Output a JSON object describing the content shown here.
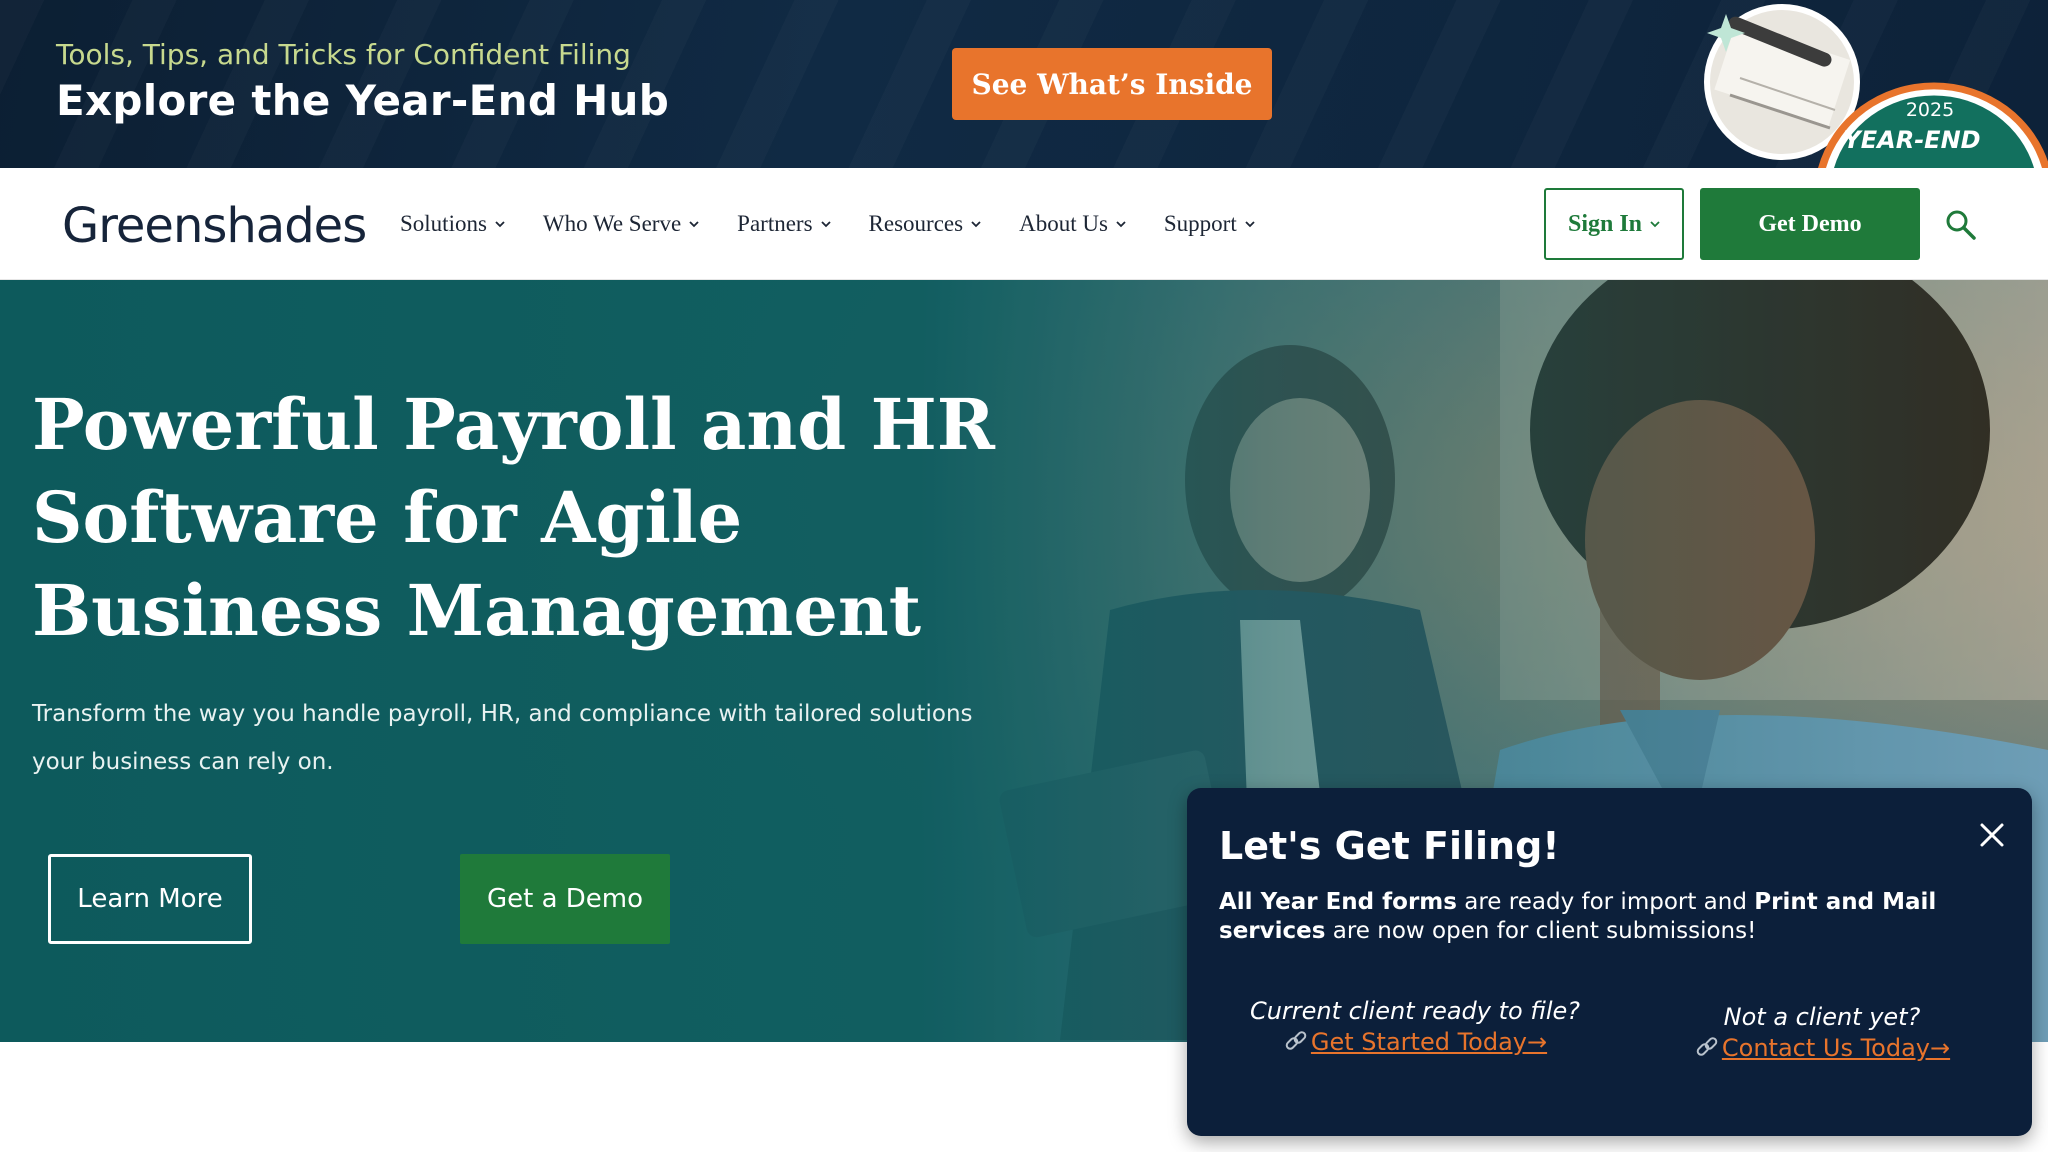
{
  "promo": {
    "kicker": "Tools, Tips, and Tricks for Confident Filing",
    "title": "Explore the Year-End Hub",
    "cta": "See What’s Inside",
    "badge_year": "2025",
    "badge_label": "YEAR-END",
    "cta_color": "#e8742c"
  },
  "header": {
    "logo": "Greenshades",
    "nav": [
      {
        "label": "Solutions"
      },
      {
        "label": "Who We Serve"
      },
      {
        "label": "Partners"
      },
      {
        "label": "Resources"
      },
      {
        "label": "About Us"
      },
      {
        "label": "Support"
      }
    ],
    "sign_in": "Sign In",
    "get_demo": "Get Demo",
    "search_icon": "search-icon",
    "brand_green": "#1f7a3a"
  },
  "hero": {
    "title": "Powerful Payroll and HR Software for Agile Business Management",
    "subtitle": "Transform the way you handle payroll, HR, and compliance with tailored solutions your business can rely on.",
    "learn_more": "Learn More",
    "get_a_demo": "Get a Demo",
    "bg_color": "#0e5a5c"
  },
  "popup": {
    "title": "Let's Get Filing!",
    "body_strong_1": "All Year End forms",
    "body_text_1": " are ready for import and ",
    "body_strong_2": "Print and Mail services",
    "body_text_2": " are now open for client submissions!",
    "left_question": "Current client ready to file?",
    "left_link": "Get Started Today→",
    "right_question": "Not a client yet?",
    "right_link": "Contact Us Today→",
    "close_icon": "close-icon",
    "bg_color": "#0c1f3a",
    "link_color": "#e8742c"
  }
}
